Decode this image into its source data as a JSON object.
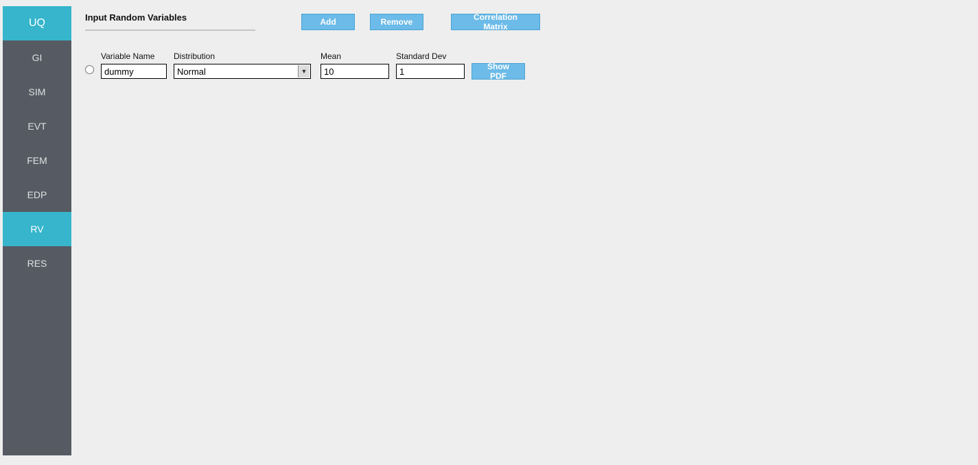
{
  "sidebar": {
    "items": [
      {
        "label": "UQ"
      },
      {
        "label": "GI"
      },
      {
        "label": "SIM"
      },
      {
        "label": "EVT"
      },
      {
        "label": "FEM"
      },
      {
        "label": "EDP"
      },
      {
        "label": "RV"
      },
      {
        "label": "RES"
      }
    ]
  },
  "header": {
    "title": "Input Random Variables",
    "buttons": {
      "add": "Add",
      "remove": "Remove",
      "correlation": "Correlation Matrix"
    }
  },
  "columns": {
    "variable_name": "Variable Name",
    "distribution": "Distribution",
    "mean": "Mean",
    "std": "Standard Dev"
  },
  "row": {
    "variable_name": "dummy",
    "distribution": "Normal",
    "mean": "10",
    "std": "1",
    "show_pdf": "Show PDF"
  }
}
